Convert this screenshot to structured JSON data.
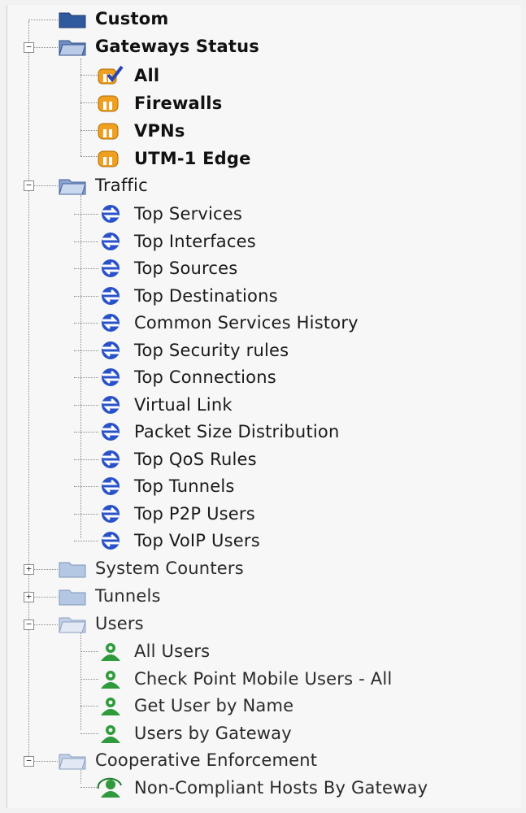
{
  "tree": {
    "custom": "Custom",
    "gateways_status": {
      "label": "Gateways Status",
      "items": [
        "All",
        "Firewalls",
        "VPNs",
        "UTM-1 Edge"
      ]
    },
    "traffic": {
      "label": "Traffic",
      "items": [
        "Top Services",
        "Top Interfaces",
        "Top Sources",
        "Top Destinations",
        "Common Services History",
        "Top Security rules",
        "Top Connections",
        "Virtual Link",
        "Packet Size Distribution",
        "Top QoS Rules",
        "Top Tunnels",
        "Top P2P Users",
        "Top VoIP Users"
      ]
    },
    "system_counters": "System Counters",
    "tunnels": "Tunnels",
    "users": {
      "label": "Users",
      "items": [
        "All Users",
        "Check Point Mobile Users - All",
        "Get User by Name",
        "Users by Gateway"
      ]
    },
    "cooperative_enforcement": {
      "label": "Cooperative Enforcement",
      "items": [
        "Non-Compliant Hosts By Gateway"
      ]
    }
  },
  "colors": {
    "folder_blue": "#2f5a9e",
    "gateway_orange": "#f0a020",
    "traffic_blue": "#2a52c8",
    "users_green": "#2e9a3c"
  }
}
